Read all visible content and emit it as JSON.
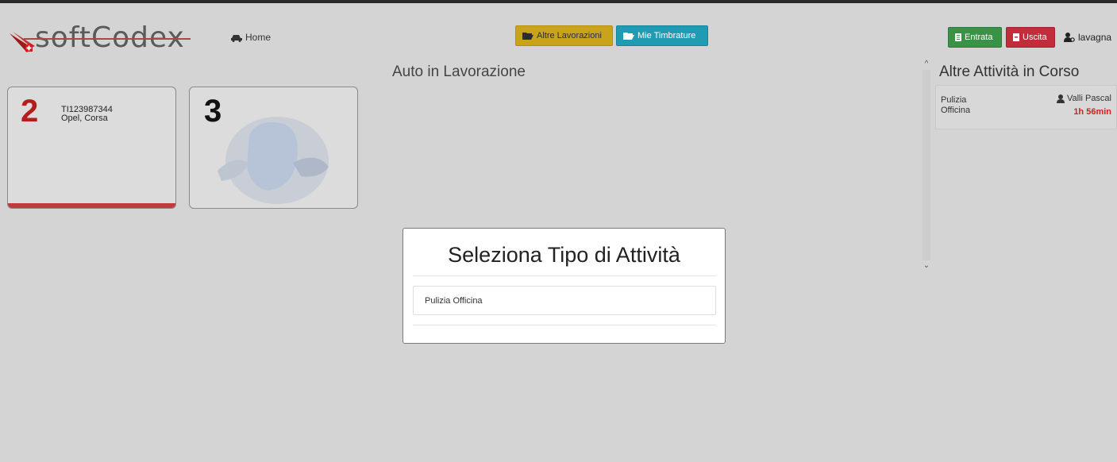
{
  "brand": {
    "logo_text": "softCodex"
  },
  "nav": {
    "home_label": "Home",
    "altre_label": "Altre Lavorazioni",
    "mie_label": "Mie Timbrature",
    "entrata_label": "Entrata",
    "uscita_label": "Uscita",
    "user_label": "lavagna"
  },
  "main": {
    "title": "Auto in Lavorazione",
    "cards": [
      {
        "number": "2",
        "plate": "TI123987344",
        "model": "Opel, Corsa"
      },
      {
        "number": "3",
        "plate": "",
        "model": ""
      }
    ]
  },
  "right": {
    "title": "Altre Attività in Corso",
    "activities": [
      {
        "name": "Pulizia Officina",
        "user": "Valli Pascal",
        "time": "1h 56min"
      }
    ]
  },
  "modal": {
    "title": "Seleziona Tipo di Attività",
    "options": [
      "Pulizia Officina"
    ]
  },
  "colors": {
    "altre": "#c9a31b",
    "mie": "#1f9bb3",
    "entrata": "#3a9246",
    "uscita": "#c12d3a",
    "alert": "#d32020"
  }
}
